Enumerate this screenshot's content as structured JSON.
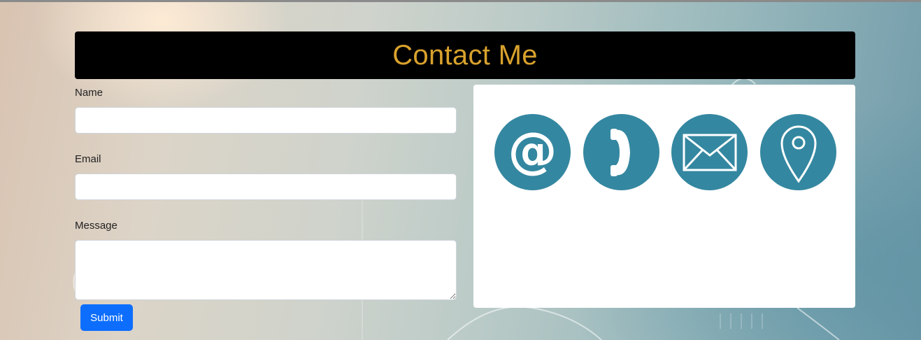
{
  "header": {
    "title": "Contact Me"
  },
  "form": {
    "name_label": "Name",
    "name_value": "",
    "email_label": "Email",
    "email_value": "",
    "message_label": "Message",
    "message_value": "",
    "submit_label": "Submit"
  },
  "contact_icons": [
    {
      "name": "at-sign-icon",
      "glyph": "@"
    },
    {
      "name": "phone-icon"
    },
    {
      "name": "envelope-icon"
    },
    {
      "name": "map-pin-icon"
    }
  ],
  "colors": {
    "header_bg": "#000000",
    "title": "#d9a22d",
    "icon_circle": "#3487a0",
    "submit": "#0d6efd"
  }
}
